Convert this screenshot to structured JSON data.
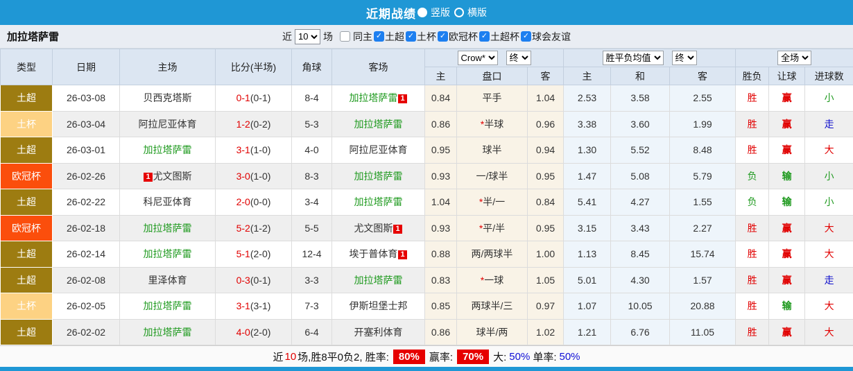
{
  "colors": {
    "accent_blue": "#1f97d5",
    "win_red": "#e10000",
    "lose_green": "#1f9a1f",
    "push_blue": "#1111cc",
    "league_super_bg": "#9d7c11",
    "league_cup_bg": "#fdd283",
    "league_ucl_bg": "#fb4e0c",
    "badge_bg": "#e60000"
  },
  "titlebar": {
    "title": "近期战绩",
    "radio_vertical": "竖版",
    "radio_horizontal": "横版"
  },
  "filterbar": {
    "team": "加拉塔萨雷",
    "near_label": "近",
    "count_value": "10",
    "matches_label": "场",
    "checkboxes": [
      {
        "label": "同主",
        "checked": false
      },
      {
        "label": "土超",
        "checked": true
      },
      {
        "label": "土杯",
        "checked": true
      },
      {
        "label": "欧冠杯",
        "checked": true
      },
      {
        "label": "土超杯",
        "checked": true
      },
      {
        "label": "球会友谊",
        "checked": true
      }
    ]
  },
  "table": {
    "dropdowns": {
      "odds_source": "Crow*",
      "odds_time": "终",
      "avg_source": "胜平负均值",
      "avg_time": "终",
      "scope": "全场"
    },
    "headers": {
      "type": "类型",
      "date": "日期",
      "home": "主场",
      "score": "比分(半场)",
      "corner": "角球",
      "away": "客场",
      "odds_home": "主",
      "odds_handicap": "盘口",
      "odds_away": "客",
      "avg_home": "主",
      "avg_draw": "和",
      "avg_away": "客",
      "result": "胜负",
      "handicap": "让球",
      "goals": "进球数"
    },
    "badge_text": "1",
    "rows": [
      {
        "type": "土超",
        "type_class": "super",
        "date": "26-03-08",
        "home": {
          "name": "贝西克塔斯",
          "green": false,
          "badge": null
        },
        "score": "0-1",
        "half": "(0-1)",
        "corner": "8-4",
        "away": {
          "name": "加拉塔萨雷",
          "green": true,
          "badge": "after"
        },
        "odds": [
          "0.84",
          "平手",
          "1.04"
        ],
        "handicap_star": false,
        "avg": [
          "2.53",
          "3.58",
          "2.55"
        ],
        "result": {
          "t": "胜",
          "c": "red"
        },
        "handicap_result": {
          "t": "赢",
          "c": "red"
        },
        "goals_result": {
          "t": "小",
          "c": "green"
        }
      },
      {
        "type": "土杯",
        "type_class": "cup",
        "date": "26-03-04",
        "home": {
          "name": "阿拉尼亚体育",
          "green": false,
          "badge": null
        },
        "score": "1-2",
        "half": "(0-2)",
        "corner": "5-3",
        "away": {
          "name": "加拉塔萨雷",
          "green": true,
          "badge": null
        },
        "odds": [
          "0.86",
          "半球",
          "0.96"
        ],
        "handicap_star": true,
        "avg": [
          "3.38",
          "3.60",
          "1.99"
        ],
        "result": {
          "t": "胜",
          "c": "red"
        },
        "handicap_result": {
          "t": "赢",
          "c": "red"
        },
        "goals_result": {
          "t": "走",
          "c": "blue"
        }
      },
      {
        "type": "土超",
        "type_class": "super",
        "date": "26-03-01",
        "home": {
          "name": "加拉塔萨雷",
          "green": true,
          "badge": null
        },
        "score": "3-1",
        "half": "(1-0)",
        "corner": "4-0",
        "away": {
          "name": "阿拉尼亚体育",
          "green": false,
          "badge": null
        },
        "odds": [
          "0.95",
          "球半",
          "0.94"
        ],
        "handicap_star": false,
        "avg": [
          "1.30",
          "5.52",
          "8.48"
        ],
        "result": {
          "t": "胜",
          "c": "red"
        },
        "handicap_result": {
          "t": "赢",
          "c": "red"
        },
        "goals_result": {
          "t": "大",
          "c": "red"
        }
      },
      {
        "type": "欧冠杯",
        "type_class": "ucl",
        "date": "26-02-26",
        "home": {
          "name": "尤文图斯",
          "green": false,
          "badge": "before"
        },
        "score": "3-0",
        "half": "(1-0)",
        "corner": "8-3",
        "away": {
          "name": "加拉塔萨雷",
          "green": true,
          "badge": null
        },
        "odds": [
          "0.93",
          "一/球半",
          "0.95"
        ],
        "handicap_star": false,
        "avg": [
          "1.47",
          "5.08",
          "5.79"
        ],
        "result": {
          "t": "负",
          "c": "green"
        },
        "handicap_result": {
          "t": "输",
          "c": "green"
        },
        "goals_result": {
          "t": "小",
          "c": "green"
        }
      },
      {
        "type": "土超",
        "type_class": "super",
        "date": "26-02-22",
        "home": {
          "name": "科尼亚体育",
          "green": false,
          "badge": null
        },
        "score": "2-0",
        "half": "(0-0)",
        "corner": "3-4",
        "away": {
          "name": "加拉塔萨雷",
          "green": true,
          "badge": null
        },
        "odds": [
          "1.04",
          "半/一",
          "0.84"
        ],
        "handicap_star": true,
        "avg": [
          "5.41",
          "4.27",
          "1.55"
        ],
        "result": {
          "t": "负",
          "c": "green"
        },
        "handicap_result": {
          "t": "输",
          "c": "green"
        },
        "goals_result": {
          "t": "小",
          "c": "green"
        }
      },
      {
        "type": "欧冠杯",
        "type_class": "ucl",
        "date": "26-02-18",
        "home": {
          "name": "加拉塔萨雷",
          "green": true,
          "badge": null
        },
        "score": "5-2",
        "half": "(1-2)",
        "corner": "5-5",
        "away": {
          "name": "尤文图斯",
          "green": false,
          "badge": "after"
        },
        "odds": [
          "0.93",
          "平/半",
          "0.95"
        ],
        "handicap_star": true,
        "avg": [
          "3.15",
          "3.43",
          "2.27"
        ],
        "result": {
          "t": "胜",
          "c": "red"
        },
        "handicap_result": {
          "t": "赢",
          "c": "red"
        },
        "goals_result": {
          "t": "大",
          "c": "red"
        }
      },
      {
        "type": "土超",
        "type_class": "super",
        "date": "26-02-14",
        "home": {
          "name": "加拉塔萨雷",
          "green": true,
          "badge": null
        },
        "score": "5-1",
        "half": "(2-0)",
        "corner": "12-4",
        "away": {
          "name": "埃于普体育",
          "green": false,
          "badge": "after"
        },
        "odds": [
          "0.88",
          "两/两球半",
          "1.00"
        ],
        "handicap_star": false,
        "avg": [
          "1.13",
          "8.45",
          "15.74"
        ],
        "result": {
          "t": "胜",
          "c": "red"
        },
        "handicap_result": {
          "t": "赢",
          "c": "red"
        },
        "goals_result": {
          "t": "大",
          "c": "red"
        }
      },
      {
        "type": "土超",
        "type_class": "super",
        "date": "26-02-08",
        "home": {
          "name": "里泽体育",
          "green": false,
          "badge": null
        },
        "score": "0-3",
        "half": "(0-1)",
        "corner": "3-3",
        "away": {
          "name": "加拉塔萨雷",
          "green": true,
          "badge": null
        },
        "odds": [
          "0.83",
          "一球",
          "1.05"
        ],
        "handicap_star": true,
        "avg": [
          "5.01",
          "4.30",
          "1.57"
        ],
        "result": {
          "t": "胜",
          "c": "red"
        },
        "handicap_result": {
          "t": "赢",
          "c": "red"
        },
        "goals_result": {
          "t": "走",
          "c": "blue"
        }
      },
      {
        "type": "土杯",
        "type_class": "cup",
        "date": "26-02-05",
        "home": {
          "name": "加拉塔萨雷",
          "green": true,
          "badge": null
        },
        "score": "3-1",
        "half": "(3-1)",
        "corner": "7-3",
        "away": {
          "name": "伊斯坦堡士邦",
          "green": false,
          "badge": null
        },
        "odds": [
          "0.85",
          "两球半/三",
          "0.97"
        ],
        "handicap_star": false,
        "avg": [
          "1.07",
          "10.05",
          "20.88"
        ],
        "result": {
          "t": "胜",
          "c": "red"
        },
        "handicap_result": {
          "t": "输",
          "c": "green"
        },
        "goals_result": {
          "t": "大",
          "c": "red"
        }
      },
      {
        "type": "土超",
        "type_class": "super",
        "date": "26-02-02",
        "home": {
          "name": "加拉塔萨雷",
          "green": true,
          "badge": null
        },
        "score": "4-0",
        "half": "(2-0)",
        "corner": "6-4",
        "away": {
          "name": "开塞利体育",
          "green": false,
          "badge": null
        },
        "odds": [
          "0.86",
          "球半/两",
          "1.02"
        ],
        "handicap_star": false,
        "avg": [
          "1.21",
          "6.76",
          "11.05"
        ],
        "result": {
          "t": "胜",
          "c": "red"
        },
        "handicap_result": {
          "t": "赢",
          "c": "red"
        },
        "goals_result": {
          "t": "大",
          "c": "red"
        }
      }
    ]
  },
  "footer": {
    "segments": [
      {
        "text": "近",
        "style": "black"
      },
      {
        "text": "10",
        "style": "red"
      },
      {
        "text": "场,胜8平0负2, 胜率:",
        "style": "black"
      },
      {
        "text": "80%",
        "style": "badge"
      },
      {
        "text": "赢率:",
        "style": "black"
      },
      {
        "text": "70%",
        "style": "badge"
      },
      {
        "text": "大:",
        "style": "black"
      },
      {
        "text": "50%",
        "style": "blue"
      },
      {
        "text": "单率:",
        "style": "black"
      },
      {
        "text": "50%",
        "style": "blue"
      }
    ]
  }
}
